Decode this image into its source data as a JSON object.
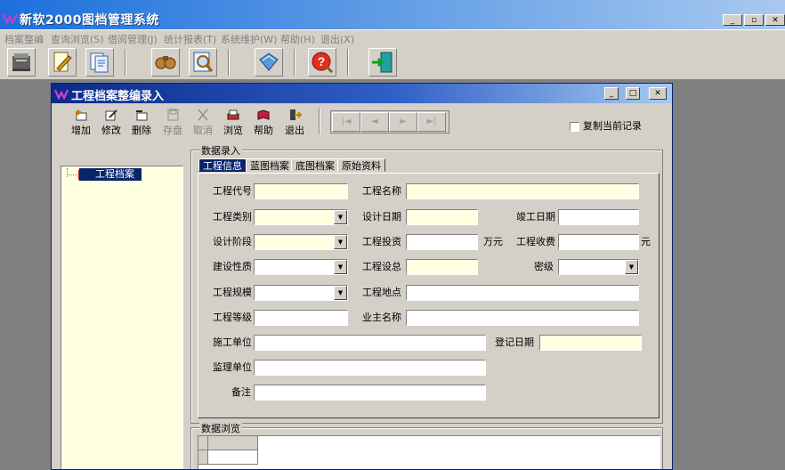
{
  "app": {
    "title": "新软2000图档管理系统",
    "background_color": "#808080"
  },
  "menubar": {
    "items": [
      {
        "label": "档案整编"
      },
      {
        "label": "查询浏览(S)"
      },
      {
        "label": "借阅管理(J)"
      },
      {
        "label": "统计报表(T)"
      },
      {
        "label": "系统维护(W)"
      },
      {
        "label": "帮助(H)"
      },
      {
        "label": "退出(X)"
      }
    ]
  },
  "main_toolbar": {
    "buttons": [
      {
        "icon": "archive-box-icon"
      },
      {
        "icon": "edit-document-icon"
      },
      {
        "icon": "documents-icon"
      },
      {
        "icon": "search-binoculars-icon"
      },
      {
        "icon": "magnifier-page-icon"
      },
      {
        "icon": "folder-book-icon"
      },
      {
        "icon": "help-icon"
      },
      {
        "icon": "exit-door-icon"
      }
    ]
  },
  "window": {
    "title": "工程档案整编录入",
    "toolbar": {
      "add_label": "增加",
      "edit_label": "修改",
      "delete_label": "删除",
      "save_label": "存盘",
      "cancel_label": "取消",
      "browse_label": "浏览",
      "help_label": "帮助",
      "exit_label": "退出"
    },
    "copy_current_label": "复制当前记录",
    "tree": {
      "root_label": "工程档案"
    },
    "data_entry_label": "数据录入",
    "tabs": [
      {
        "label": "工程信息",
        "active": true
      },
      {
        "label": "蓝图档案",
        "active": false
      },
      {
        "label": "底图档案",
        "active": false
      },
      {
        "label": "原始资料",
        "active": false
      }
    ],
    "form": {
      "project_code_label": "工程代号",
      "project_name_label": "工程名称",
      "project_type_label": "工程类别",
      "design_date_label": "设计日期",
      "completion_date_label": "竣工日期",
      "design_stage_label": "设计阶段",
      "investment_label": "工程投资",
      "investment_unit": "万元",
      "fee_label": "工程收费",
      "fee_unit": "元",
      "construction_nature_label": "建设性质",
      "designer_label": "工程设总",
      "secret_level_label": "密级",
      "scale_label": "工程规模",
      "location_label": "工程地点",
      "grade_label": "工程等级",
      "owner_label": "业主名称",
      "contractor_label": "施工单位",
      "register_date_label": "登记日期",
      "supervisor_label": "监理单位",
      "remark_label": "备注"
    },
    "data_browse_label": "数据浏览"
  }
}
